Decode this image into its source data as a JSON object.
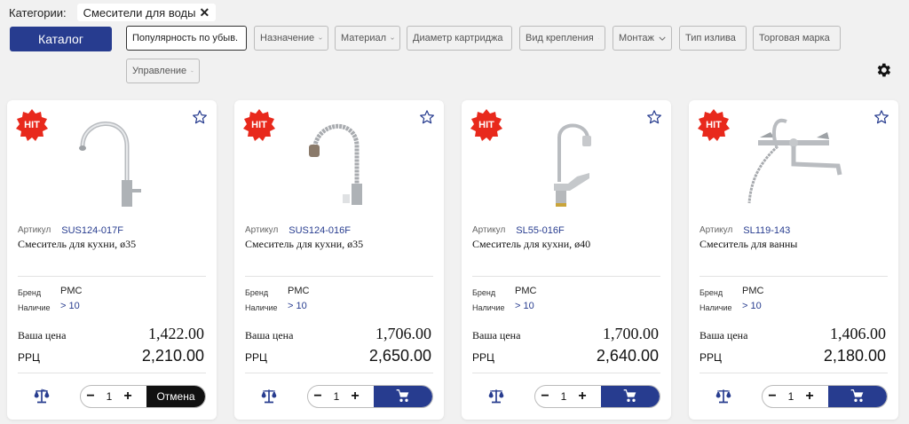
{
  "categories": {
    "label": "Категории:",
    "chip": "Смесители для воды",
    "chip_remove": "✕"
  },
  "catalog_button": "Каталог",
  "filters": {
    "sort": "Популярность по убыв.",
    "items": [
      "Назначение",
      "Материал",
      "Диаметр картриджа",
      "Вид крепления",
      "Монтаж",
      "Тип излива",
      "Торговая марка",
      "Управление"
    ]
  },
  "labels": {
    "article": "Артикул",
    "brand": "Бренд",
    "stock": "Наличие",
    "your_price": "Ваша цена",
    "rrc": "РРЦ",
    "hit": "HIT",
    "cancel": "Отмена"
  },
  "products": [
    {
      "code": "SUS124-017F",
      "title": "Смеситель для кухни, ø35",
      "brand": "PMC",
      "stock": "> 10",
      "price": "1,422.00",
      "rrc": "2,210.00",
      "qty": "1",
      "minus": "−",
      "plus": "+",
      "action": "cancel"
    },
    {
      "code": "SUS124-016F",
      "title": "Смеситель для кухни, ø35",
      "brand": "PMC",
      "stock": "> 10",
      "price": "1,706.00",
      "rrc": "2,650.00",
      "qty": "1",
      "minus": "−",
      "plus": "+",
      "action": "cart"
    },
    {
      "code": "SL55-016F",
      "title": "Смеситель для кухни, ø40",
      "brand": "PMC",
      "stock": "> 10",
      "price": "1,700.00",
      "rrc": "2,640.00",
      "qty": "1",
      "minus": "−",
      "plus": "+",
      "action": "cart"
    },
    {
      "code": "SL119-143",
      "title": "Смеситель для ванны",
      "brand": "PMC",
      "stock": "> 10",
      "price": "1,406.00",
      "rrc": "2,180.00",
      "qty": "1",
      "minus": "−",
      "plus": "+",
      "action": "cart"
    }
  ],
  "colors": {
    "accent": "#273c8f",
    "hit": "#e8291c"
  }
}
